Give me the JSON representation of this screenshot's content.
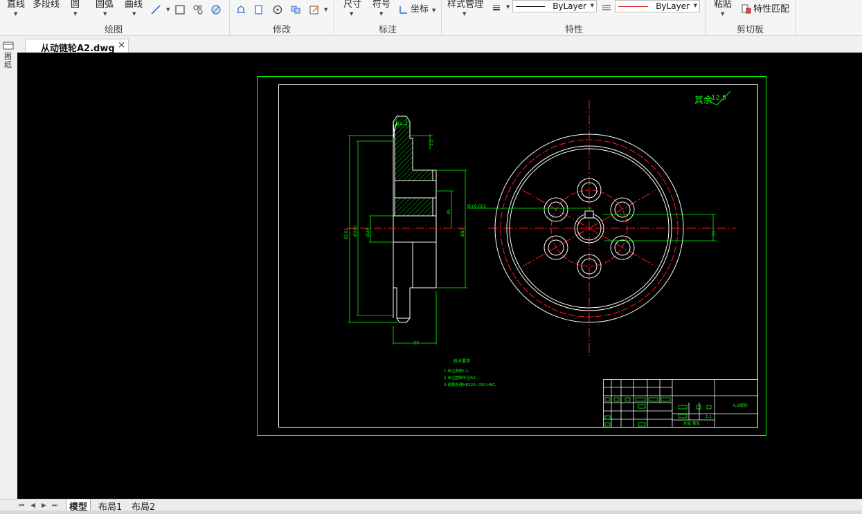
{
  "ribbon": {
    "draw": {
      "line": "直线",
      "polyline": "多段线",
      "circle": "圆",
      "arc": "圆弧",
      "curve": "曲线",
      "title": "绘图"
    },
    "modify": {
      "title": "修改"
    },
    "annotate": {
      "dimension": "尺寸",
      "symbol": "符号",
      "coordinate": "坐标",
      "title": "标注"
    },
    "properties": {
      "style_manager": "样式管理",
      "linetype_value": "ByLayer",
      "color_value": "ByLayer",
      "title": "特性",
      "colors": {
        "linetype": "#000000",
        "color": "#e02020"
      }
    },
    "clipboard": {
      "paste": "粘贴",
      "match_properties": "特性匹配",
      "title": "剪切板"
    }
  },
  "sidebar": {
    "label": "图纸"
  },
  "document_tab": {
    "title": "从动链轮A2.dwg",
    "close": "×"
  },
  "drawing": {
    "surface_finish": "其余",
    "roughness": "12.5",
    "dims": {
      "top_width": "21",
      "chamfer": "1.5",
      "total_diameter": "Ø261",
      "d240": "Ø240",
      "bore": "Ø28",
      "hub": "Ø87",
      "groove": "45",
      "bottom_width": "55",
      "keyway": "31",
      "tolerance": "Ø±0.022"
    },
    "notes": {
      "title": "技术要求",
      "lines": [
        "1.未注倒角C2。",
        "2.未注圆角半径R2。",
        "3.调质处理HB220~250 HRC。"
      ]
    },
    "title_block": {
      "part_name": "从动链轮",
      "scale": "1:1",
      "sheet": "共张 第张"
    },
    "colors": {
      "background": "#000000",
      "frame": "#00ff00",
      "lines": "#ffffff",
      "center": "#ff1a1a"
    }
  },
  "layout_tabs": {
    "nav": [
      "⏮",
      "◀",
      "▶",
      "⏭"
    ],
    "tabs": [
      "模型",
      "布局1",
      "布局2"
    ],
    "active": "模型"
  }
}
